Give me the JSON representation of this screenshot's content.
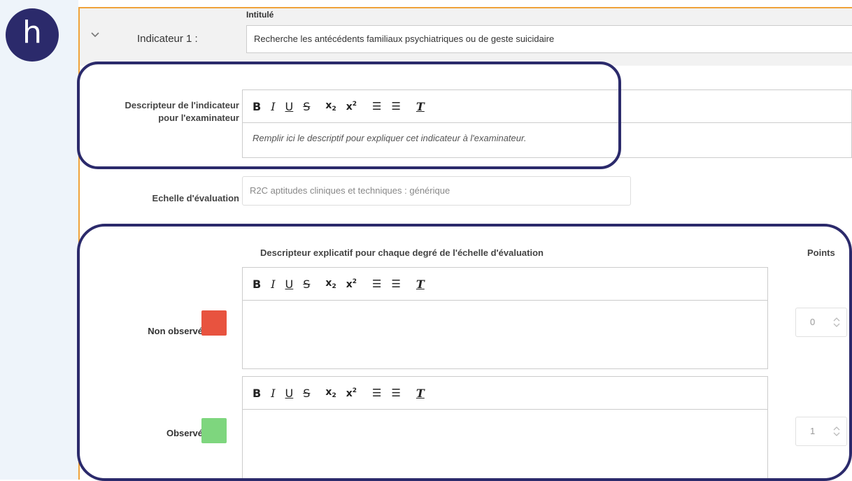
{
  "avatar": {
    "letter": "h"
  },
  "indicator": {
    "label": "Indicateur 1 :",
    "title_field_label": "Intitulé",
    "title_value": "Recherche les antécédents familiaux psychiatriques ou de geste suicidaire"
  },
  "descriptor": {
    "label": "Descripteur de l'indicateur pour l'examinateur",
    "label_line1": "Descripteur de l'indicateur",
    "label_line2": "pour l'examinateur",
    "placeholder": "Remplir ici le descriptif pour expliquer cet indicateur à l'examinateur."
  },
  "scale": {
    "label": "Echelle d'évaluation",
    "value": "R2C aptitudes cliniques et techniques : générique"
  },
  "grid": {
    "heading": "Descripteur explicatif pour chaque degré de l'échelle d'évaluation",
    "points_heading": "Points",
    "rows": [
      {
        "label": "Non observé",
        "color": "#e8533f",
        "points": "0"
      },
      {
        "label": "Observé",
        "color": "#7ed67e",
        "points": "1"
      }
    ]
  },
  "toolbar": {
    "bold": "B",
    "italic": "I",
    "underline": "U",
    "strike": "S",
    "subscript": "x",
    "subscript_mark": "2",
    "superscript": "x",
    "superscript_mark": "2",
    "ordered_list": "☰",
    "bullet_list": "☰",
    "clear_format": "T",
    "icons": [
      "bold-icon",
      "italic-icon",
      "underline-icon",
      "strike-icon",
      "subscript-icon",
      "superscript-icon",
      "ordered-list-icon",
      "bullet-list-icon",
      "clear-format-icon"
    ]
  },
  "colors": {
    "ring": "#2b2a6b",
    "panel_border": "#f0a23a"
  }
}
